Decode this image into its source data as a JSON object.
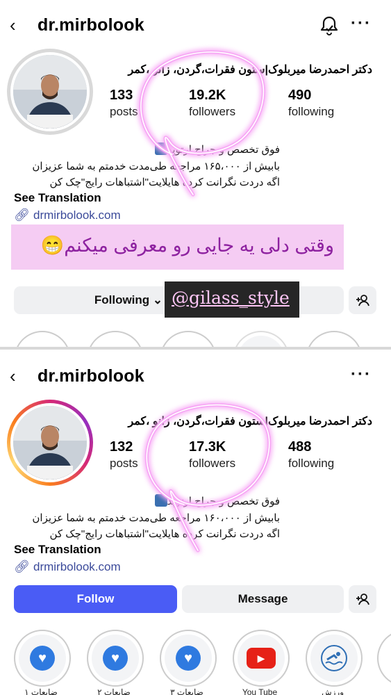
{
  "overlay": {
    "caption": "وقتی دلی یه جایی رو معرفی میکنم😁",
    "tag": "@gilass_style"
  },
  "top": {
    "username": "dr.mirbolook",
    "full_name": "دکتر احمدرضا میربلوک|ستون فقرات،گردن، زانو ،کمر",
    "stats": [
      {
        "value": "133",
        "label": "posts"
      },
      {
        "value": "19.2K",
        "label": "followers"
      },
      {
        "value": "490",
        "label": "following"
      }
    ],
    "bio": [
      "فوق تخصص و جراح ارتوپد",
      "بابیش از ۱۶۵،۰۰۰ مراجعه طی‌مدت خدمتم به شما عزیزان",
      "اگه دردت نگرانت کرده هایلایت\"اشتباهات رایج\"چک کن"
    ],
    "see_translation": "See Translation",
    "link": "drmirbolook.com",
    "following_button": "Following ⌄"
  },
  "bottom": {
    "username": "dr.mirbolook",
    "full_name": "دکتر احمدرضا میربلوک|ستون فقرات،گردن، زانو ،کمر",
    "stats": [
      {
        "value": "132",
        "label": "posts"
      },
      {
        "value": "17.3K",
        "label": "followers"
      },
      {
        "value": "488",
        "label": "following"
      }
    ],
    "bio": [
      "فوق تخصص و جراح ارتوپد",
      "بابیش از ۱۶۰،۰۰۰ مراجعه طی‌مدت خدمتم به شما عزیزان",
      "اگه دردت نگرانت کرده هایلایت\"اشتباهات رایج\"چک کن"
    ],
    "see_translation": "See Translation",
    "link": "drmirbolook.com",
    "follow_button": "Follow",
    "message_button": "Message",
    "highlights": [
      "ضایعات ۱",
      "ضایعات ۲",
      "ضایعات ۳",
      "You Tube",
      "ورزش"
    ]
  },
  "colors": {
    "follow_blue": "#4a5cf5",
    "neon_pink": "#f7a8f5",
    "story_ring": [
      "#feda75",
      "#fa7e1e",
      "#d62976",
      "#962fbf"
    ]
  }
}
